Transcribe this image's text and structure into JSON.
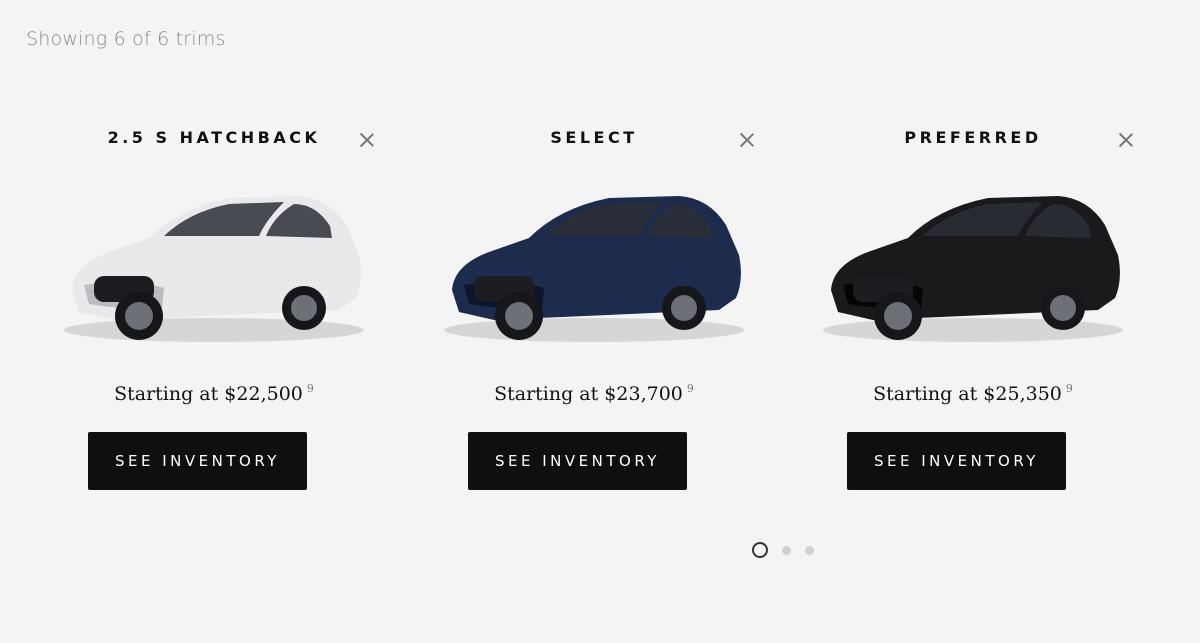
{
  "summary": "Showing 6 of 6 trims",
  "trims": [
    {
      "name": "2.5 S HATCHBACK",
      "price": "Starting at $22,500",
      "footnote": "9",
      "button": "SEE INVENTORY",
      "color": "#e9e9eb",
      "shade": "#b9bcc1"
    },
    {
      "name": "SELECT",
      "price": "Starting at $23,700",
      "footnote": "9",
      "button": "SEE INVENTORY",
      "color": "#1d2b4d",
      "shade": "#0d152a"
    },
    {
      "name": "PREFERRED",
      "price": "Starting at $25,350",
      "footnote": "9",
      "button": "SEE INVENTORY",
      "color": "#1a1a1c",
      "shade": "#050506"
    }
  ],
  "pagination": {
    "pages": 3,
    "current": 1
  }
}
